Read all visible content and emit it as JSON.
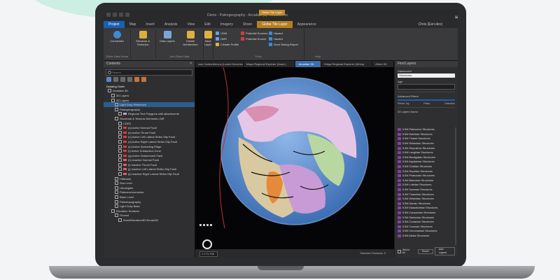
{
  "app": {
    "title": "Demo - Paleogeography - Arcadian (0) - ArcGIS Pro",
    "context_tab": "Globe Tile Layer",
    "user": "Chris (Esri.dev)"
  },
  "ribbon_tabs": [
    "Project",
    "Map",
    "Insert",
    "Analysis",
    "View",
    "Edit",
    "Imagery",
    "Share",
    "Globe Tile Layer",
    "Appearance"
  ],
  "ribbon": {
    "buttons": [
      {
        "label": "Connected",
        "color": "#3c8bd6"
      },
      {
        "label": "Structure & Tectonics",
        "color": "#d9b13a"
      },
      {
        "label": "Data Layers",
        "color": "#7aa5d8"
      },
      {
        "label": "Create Architecture",
        "color": "#e0b040"
      },
      {
        "label": "Save Layer",
        "color": "#e0b040"
      }
    ],
    "small": [
      "UDM",
      "DMS",
      "Climate Profile",
      "Potential Sources",
      "Potential Source",
      "Hazard",
      "Hazard",
      "Send Dialog Report"
    ],
    "groups": [
      "Globe Data Home",
      "Join Globe Data",
      "Tools",
      "Help"
    ]
  },
  "contents": {
    "title": "Contents",
    "search_placeholder": "Search",
    "drawing_order": "Drawing Order",
    "items": [
      {
        "label": "Arcadian 3D",
        "indent": 0,
        "sym": "none"
      },
      {
        "label": "3D Layers",
        "indent": 1,
        "sym": "none"
      },
      {
        "label": "2D Layers",
        "indent": 1,
        "sym": "none"
      },
      {
        "label": "Light Gray Reference",
        "indent": 2,
        "sym": "none",
        "selected": true
      },
      {
        "label": "Paleogeography",
        "indent": 2,
        "sym": "none"
      },
      {
        "label": "Regional Tect Polygons with attachments",
        "indent": 3,
        "sym": "#c79ad6"
      },
      {
        "label": "Structural & Tectonic Elements LNR",
        "indent": 2,
        "sym": "none"
      },
      {
        "label": "CDED",
        "indent": 3,
        "sym": "none"
      },
      {
        "label": "(a) Active Normal Fault",
        "indent": 3,
        "sym": "#e23a3a"
      },
      {
        "label": "(b) Active Thrust Fault",
        "indent": 3,
        "sym": "#e23a3a"
      },
      {
        "label": "(c) Active Left Lateral Strike-Slip Fault",
        "indent": 3,
        "sym": "#e23a3a"
      },
      {
        "label": "(d) Active Right Lateral Strike-Slip Fault",
        "indent": 3,
        "sym": "#e23a3a"
      },
      {
        "label": "(e) Active Spreading Ridge",
        "indent": 3,
        "sym": "#e23a3a"
      },
      {
        "label": "(f) Active Subduction Zone",
        "indent": 3,
        "sym": "#e23a3a"
      },
      {
        "label": "(g) Active Detachment Fault",
        "indent": 3,
        "sym": "#e23a3a"
      },
      {
        "label": "(h) Inactive Normal Fault",
        "indent": 3,
        "sym": "#e06060"
      },
      {
        "label": "(i) Inactive Thrust Fault",
        "indent": 3,
        "sym": "#e06060"
      },
      {
        "label": "(j) Inactive Left Lateral Strike-Slip Fault",
        "indent": 3,
        "sym": "#e06060"
      },
      {
        "label": "(k) Inactive Right Lateral Strike-Slip Fault",
        "indent": 3,
        "sym": "#e06060"
      },
      {
        "label": "Hillshade",
        "indent": 2,
        "sym": "none"
      },
      {
        "label": "Sea Level",
        "indent": 2,
        "sym": "none"
      },
      {
        "label": "Lithologies",
        "indent": 2,
        "sym": "none"
      },
      {
        "label": "Paleoenvironments",
        "indent": 2,
        "sym": "none"
      },
      {
        "label": "Base Level",
        "indent": 2,
        "sym": "none"
      },
      {
        "label": "Paleotopography",
        "indent": 2,
        "sym": "none"
      },
      {
        "label": "Light Gray Base",
        "indent": 2,
        "sym": "none"
      },
      {
        "label": "Elevation Surfaces",
        "indent": 1,
        "sym": "none"
      },
      {
        "label": "Ground",
        "indent": 2,
        "sym": "none"
      },
      {
        "label": "WorldElevation3D/Terrain3D",
        "indent": 3,
        "sym": "none"
      }
    ]
  },
  "view_tabs": [
    "own Carboniferous (Lower Devonian)",
    "Mega Regional Explorer (Austr.)",
    "Arcadian 3D",
    "Mega Regional Explorer (Africa)",
    "Alfred 3D"
  ],
  "status": {
    "scale": "1:173,758 m",
    "selected": "Selected Features: 0"
  },
  "find_layers": {
    "title": "Find Layers",
    "data_source_label": "Datasource",
    "data_source_value": "Structures",
    "age_label": "Age",
    "advanced_filters": "Advanced Filters",
    "filter_labels": [
      "Period Joy",
      "Paleo",
      "Detection"
    ],
    "results_label": "33 Layers found",
    "layers": [
      "5.5M Paleocene Structures",
      "5.5M Dalchian Structures",
      "5.5M Thanet Structures",
      "5.5M Selandian Structures",
      "5.5M Serpukhov Structures",
      "5.5M Langhian Structures",
      "5.5M Burdigalian Structures",
      "5.5M Aquitanian Structures",
      "5.5M Chattian Structures",
      "5.5M Rupelian Structures",
      "5.5M Priabonian Structures",
      "5.5M Bartonian Structures",
      "5.5M Lutetian Structures",
      "5.5M Ypresian Structures",
      "5.5M Thanetian Structures",
      "5.5M Selandian Structures",
      "5.5M Danian Structures",
      "5.5M Maastrichtian Structures",
      "5.5M Campanian Structures",
      "5.5M Santonian Structures",
      "5.5M Coniacian Structures",
      "5.5M Turonian Structures",
      "5.5M Cenomanian Structures",
      "5.5M Albian Structures"
    ],
    "select_all": "Select All",
    "reset": "Reset",
    "add_layers": "Add Layers"
  }
}
